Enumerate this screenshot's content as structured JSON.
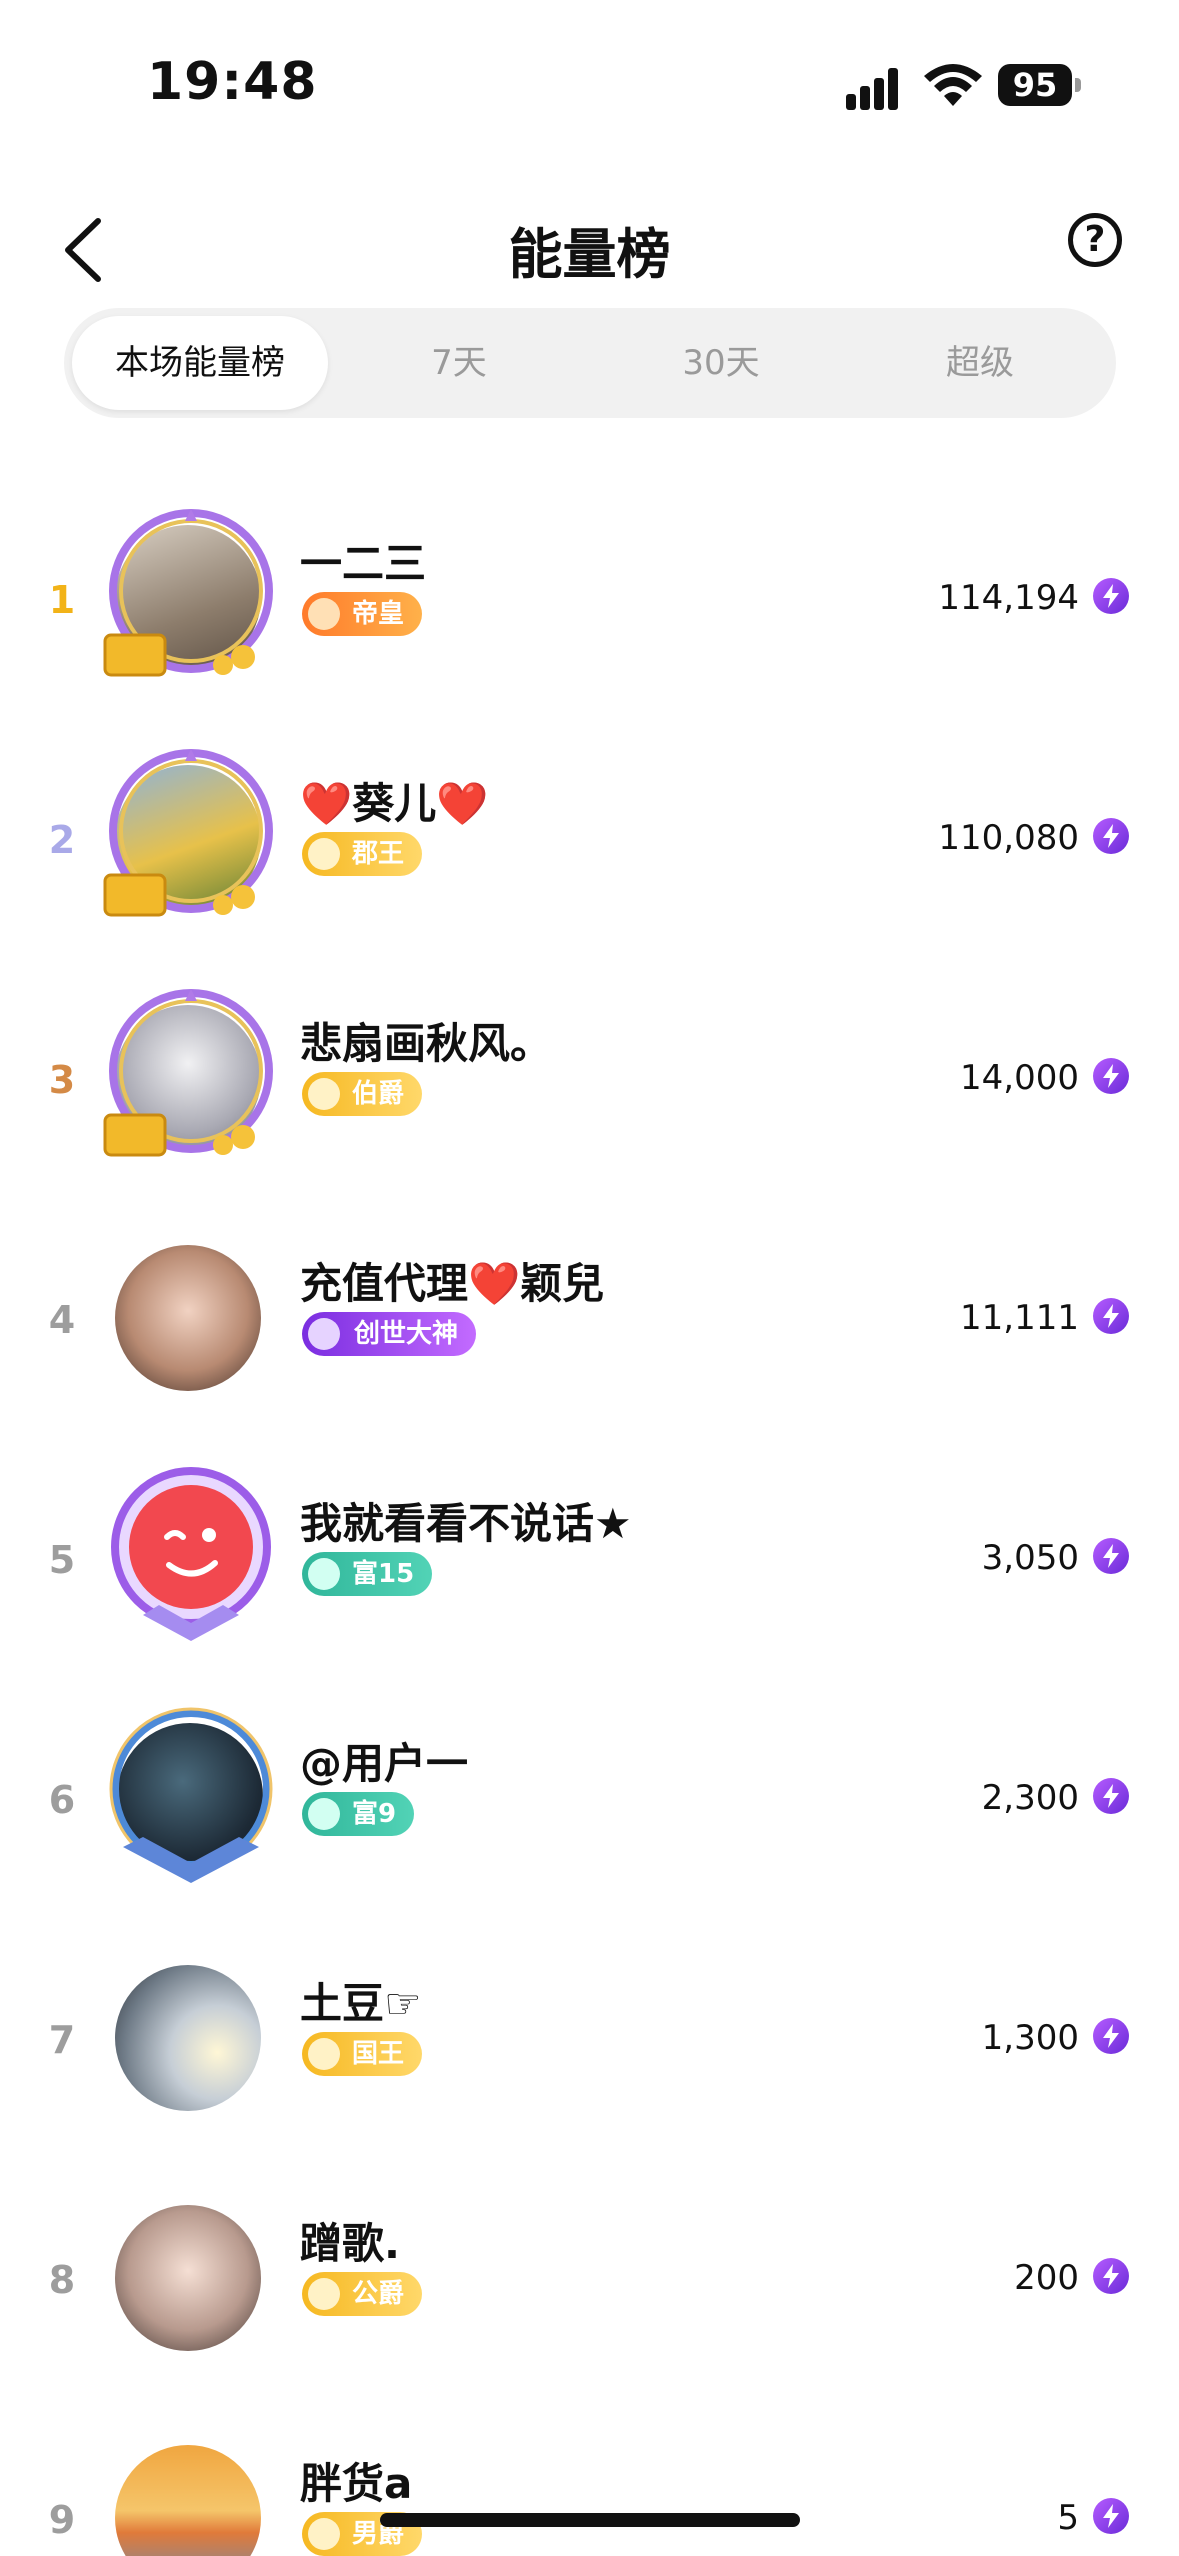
{
  "status": {
    "time": "19:48",
    "battery": "95"
  },
  "header": {
    "title": "能量榜",
    "help": "?"
  },
  "tabs": [
    {
      "label": "本场能量榜",
      "active": true
    },
    {
      "label": "7天",
      "active": false
    },
    {
      "label": "30天",
      "active": false
    },
    {
      "label": "超级",
      "active": false
    }
  ],
  "ranking": [
    {
      "rank": "1",
      "name": "一二三",
      "badge": "帝皇",
      "score": "114,194",
      "rank_color": "#f2b318"
    },
    {
      "rank": "2",
      "name": "❤️葵儿❤️",
      "badge": "郡王",
      "score": "110,080",
      "rank_color": "#a9a9e8"
    },
    {
      "rank": "3",
      "name": "悲扇画秋风。",
      "badge": "伯爵",
      "score": "14,000",
      "rank_color": "#d48a46"
    },
    {
      "rank": "4",
      "name": "充值代理❤️颖兒",
      "badge": "创世大神",
      "score": "11,111"
    },
    {
      "rank": "5",
      "name": "我就看看不说话★",
      "badge": "富15",
      "score": "3,050"
    },
    {
      "rank": "6",
      "name": "@用户一",
      "badge": "富9",
      "score": "2,300"
    },
    {
      "rank": "7",
      "name": "土豆☞",
      "badge": "国王",
      "score": "1,300"
    },
    {
      "rank": "8",
      "name": "蹭歌.",
      "badge": "公爵",
      "score": "200"
    },
    {
      "rank": "9",
      "name": "胖货a",
      "badge": "男爵",
      "score": "5"
    }
  ],
  "icons": {
    "back": "chevron-left-icon",
    "help": "question-circle-icon",
    "score": "energy-bolt-icon"
  }
}
